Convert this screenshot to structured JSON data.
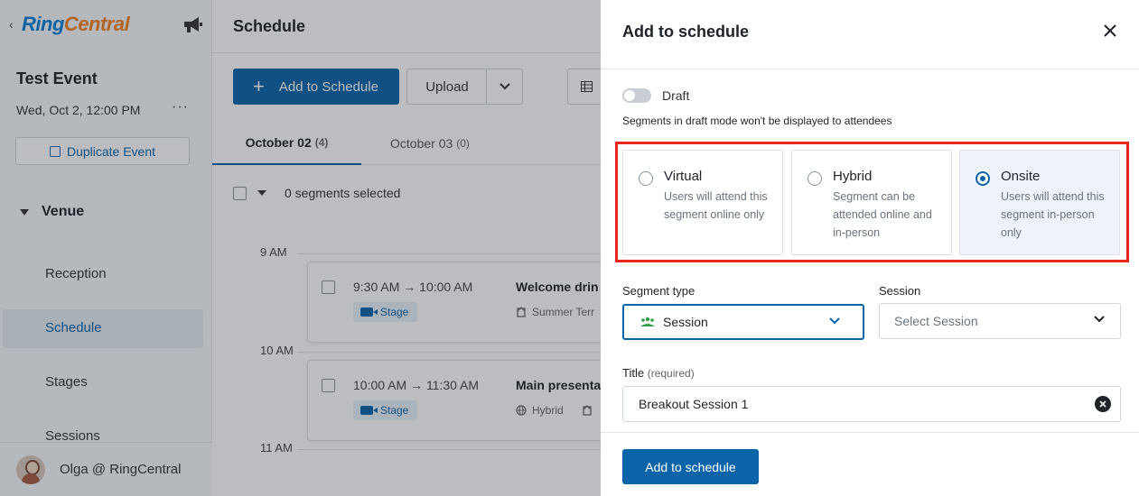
{
  "sidebar": {
    "logo_part1": "Ring",
    "logo_part2": "Central",
    "event_title": "Test Event",
    "event_date": "Wed, Oct 2, 12:00 PM",
    "more": "···",
    "duplicate_label": "Duplicate Event",
    "venue_label": "Venue",
    "items": [
      {
        "label": "Reception"
      },
      {
        "label": "Schedule"
      },
      {
        "label": "Stages"
      },
      {
        "label": "Sessions"
      }
    ],
    "active_item": "Schedule",
    "user_name": "Olga @ RingCentral"
  },
  "main": {
    "title": "Schedule",
    "add_button": "Add to Schedule",
    "upload_button": "Upload",
    "tabs": [
      {
        "label": "October 02",
        "count": "(4)"
      },
      {
        "label": "October 03",
        "count": "(0)"
      }
    ],
    "selection_text": "0 segments selected",
    "time_labels": [
      "9 AM",
      "10 AM",
      "11 AM"
    ],
    "segments": [
      {
        "start": "9:30 AM",
        "end": "10:00 AM",
        "stage": "Stage",
        "title": "Welcome drin",
        "location": "Summer Terr"
      },
      {
        "start": "10:00 AM",
        "end": "11:30 AM",
        "stage": "Stage",
        "title": "Main presenta",
        "location": "Hybrid"
      }
    ],
    "arrow": "→"
  },
  "panel": {
    "title": "Add to schedule",
    "draft_label": "Draft",
    "draft_enabled": false,
    "draft_help": "Segments in draft mode won't be displayed to attendees",
    "options": [
      {
        "title": "Virtual",
        "description": "Users will attend this segment online only",
        "selected": false
      },
      {
        "title": "Hybrid",
        "description": "Segment can be attended online and in-person",
        "selected": false
      },
      {
        "title": "Onsite",
        "description": "Users will attend this segment in-person only",
        "selected": true
      }
    ],
    "segment_type_label": "Segment type",
    "segment_type_value": "Session",
    "session_label": "Session",
    "session_placeholder": "Select Session",
    "title_label": "Title",
    "title_required": "(required)",
    "title_value": "Breakout Session 1",
    "submit_label": "Add to schedule"
  },
  "colors": {
    "primary": "#0b64a8",
    "highlight": "#e8261e",
    "logo_blue": "#0b7fd6",
    "logo_orange": "#f58220"
  }
}
